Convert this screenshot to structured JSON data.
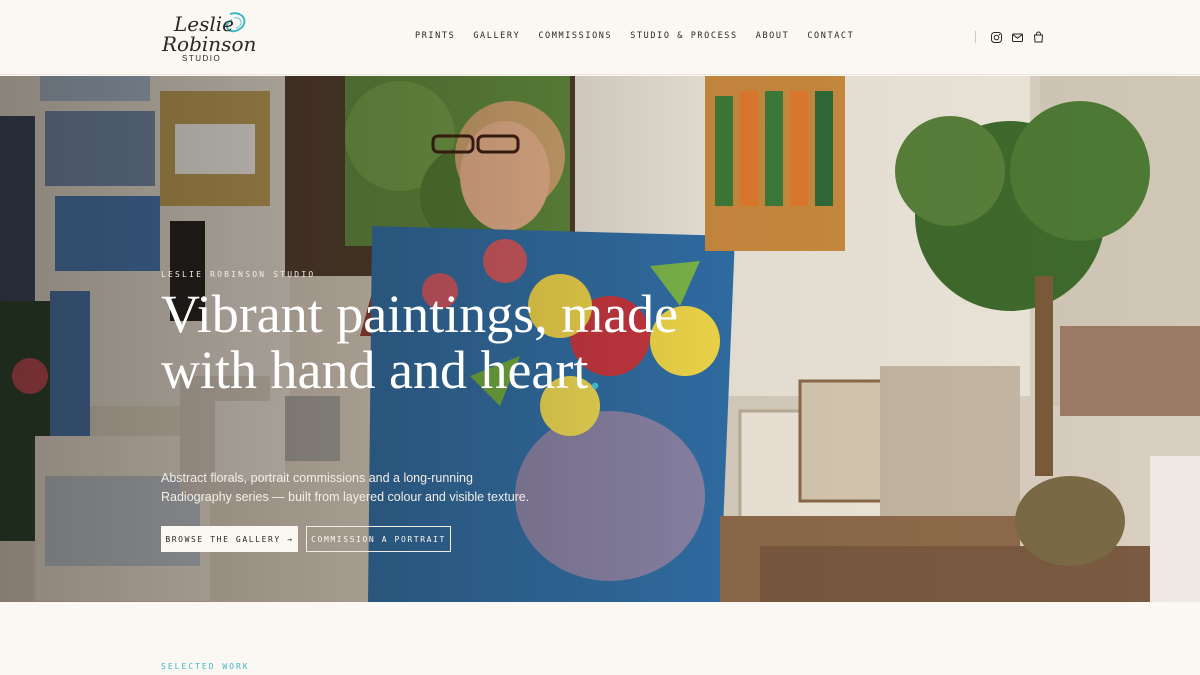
{
  "brand": {
    "logo_line1": "Leslie",
    "logo_line2": "Robinson",
    "logo_line3": "STUDIO"
  },
  "nav": {
    "items": [
      {
        "label": "PRINTS"
      },
      {
        "label": "GALLERY"
      },
      {
        "label": "COMMISSIONS"
      },
      {
        "label": "STUDIO & PROCESS"
      },
      {
        "label": "ABOUT"
      },
      {
        "label": "CONTACT"
      }
    ],
    "icons": [
      "instagram-icon",
      "mail-icon",
      "cart-icon"
    ]
  },
  "hero": {
    "eyebrow": "LESLIE ROBINSON STUDIO",
    "headline": "Vibrant paintings, made with hand and heart",
    "headline_dot": ".",
    "subtext": "Abstract florals, portrait commissions and a long-running Radiography series — built from layered colour and visible texture.",
    "primary_button": "BROWSE THE GALLERY →",
    "secondary_button": "COMMISSION A PORTRAIT"
  },
  "section": {
    "label": "SELECTED WORK"
  },
  "colors": {
    "accent": "#3fb6c6",
    "background": "#fbf8f3",
    "text": "#2a2622"
  }
}
